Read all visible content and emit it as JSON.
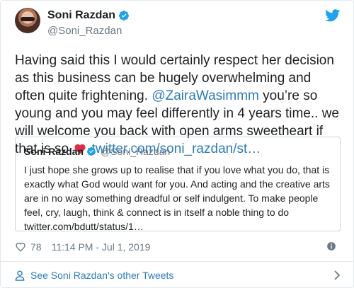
{
  "author": {
    "display_name": "Soni Razdan",
    "handle": "@Soni_Razdan",
    "avatar": "avatar-photo",
    "verified_icon": "verified-badge-icon"
  },
  "tweet": {
    "text_part1": "Having said this I would certainly respect her decision as this business can be hugely overwhelming and often quite frightening. ",
    "mention": "@ZairaWasimmm",
    "text_part2": " you’re so young and you may feel differently in 4 years time.. we will welcome you back with open arms sweetheart if that is so ",
    "link": "twitter.com/soni_razdan/st…"
  },
  "quoted_tweet": {
    "display_name": "Soni Razdan",
    "handle": "@Soni_Razdan",
    "text": "I just hope she grows up to realise that if you love what you do, that is exactly what God would want for you. And acting and the creative arts are in no way something dreadful or self indulgent. To make people feel, cry, laugh, think & connect is in itself a noble thing to do twitter.com/bdutt/status/1…"
  },
  "meta": {
    "likes": "78",
    "timestamp": "11:14 PM - Jul 1, 2019"
  },
  "footer": {
    "label": "See Soni Razdan's other Tweets"
  },
  "colors": {
    "link": "#2b7bb9",
    "heart": "#e0245e",
    "muted": "#697882",
    "twitter_blue": "#1da1f2"
  }
}
